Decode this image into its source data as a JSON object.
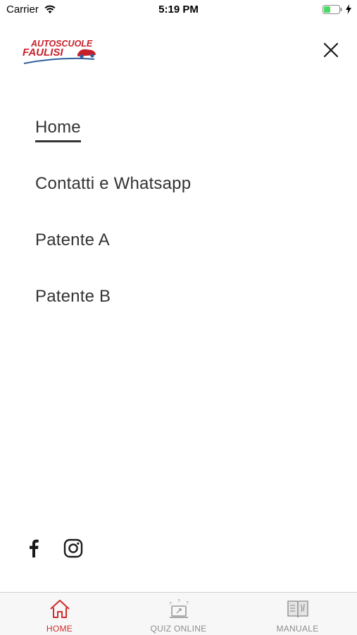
{
  "status_bar": {
    "carrier": "Carrier",
    "time": "5:19 PM"
  },
  "logo": {
    "line1": "AUTOSCUOLE",
    "line2": "FAULISI",
    "icon": "car-logo"
  },
  "header": {
    "close_icon": "close-icon"
  },
  "menu": {
    "active_index": 0,
    "items": [
      {
        "label": "Home"
      },
      {
        "label": "Contatti e Whatsapp"
      },
      {
        "label": "Patente A"
      },
      {
        "label": "Patente B"
      }
    ]
  },
  "social": {
    "icons": [
      "facebook-icon",
      "instagram-icon"
    ]
  },
  "tabbar": {
    "items": [
      {
        "label": "HOME",
        "icon": "house-icon",
        "active": true
      },
      {
        "label": "QUIZ ONLINE",
        "icon": "quiz-icon",
        "active": false
      },
      {
        "label": "MANUALE",
        "icon": "book-icon",
        "active": false
      }
    ]
  },
  "colors": {
    "accent": "#d22b2b",
    "tab_inactive": "#8d8d8d",
    "logo_red": "#c8202a",
    "logo_blue": "#2f5f9e"
  }
}
